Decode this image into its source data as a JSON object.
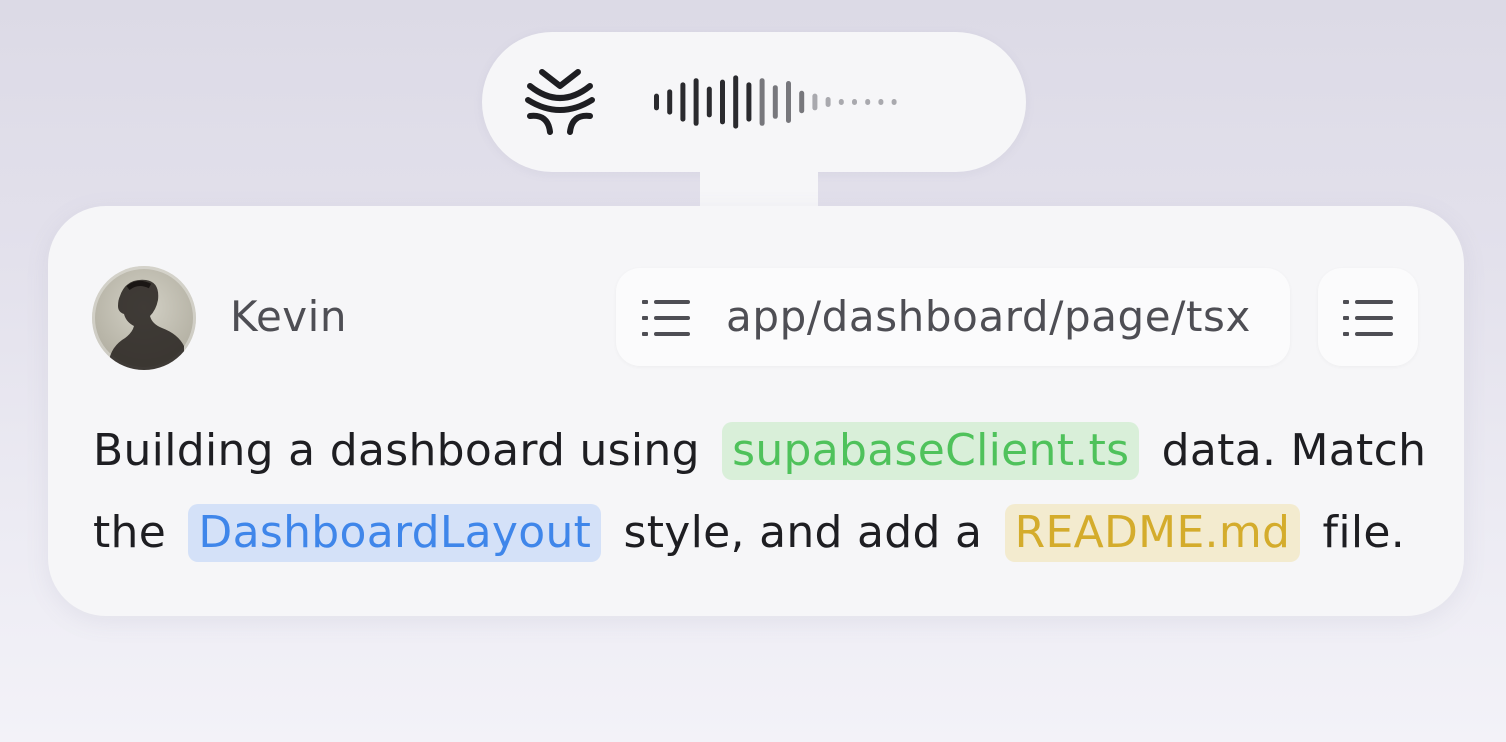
{
  "voice": {
    "logo_icon": "brand-logo-icon",
    "waveform_icon": "audio-waveform-icon",
    "waveform_level": [
      0.3,
      0.45,
      0.7,
      0.85,
      0.55,
      0.8,
      0.95,
      0.7,
      0.85,
      0.6,
      0.75,
      0.4,
      0.3,
      0.18,
      0.1,
      0.08,
      0.08,
      0.08,
      0.1
    ]
  },
  "author": {
    "name": "Kevin",
    "avatar_icon": "user-avatar"
  },
  "file": {
    "path": "app/dashboard/page/tsx",
    "icon": "list-icon"
  },
  "menu": {
    "icon": "list-icon"
  },
  "prompt": {
    "seg1": "Building a dashboard using",
    "tag1": "supabaseClient.ts",
    "seg2": "data. Match the",
    "tag2": "DashboardLayout",
    "seg3": "style, and add a",
    "tag3": "README.md",
    "seg4": "file."
  },
  "colors": {
    "tag_green_text": "#4fc25b",
    "tag_green_bg": "#d9efd9",
    "tag_blue_text": "#3f86ea",
    "tag_blue_bg": "#d4e1f8",
    "tag_yellow_text": "#d4ac2c",
    "tag_yellow_bg": "#f3ebcf"
  }
}
